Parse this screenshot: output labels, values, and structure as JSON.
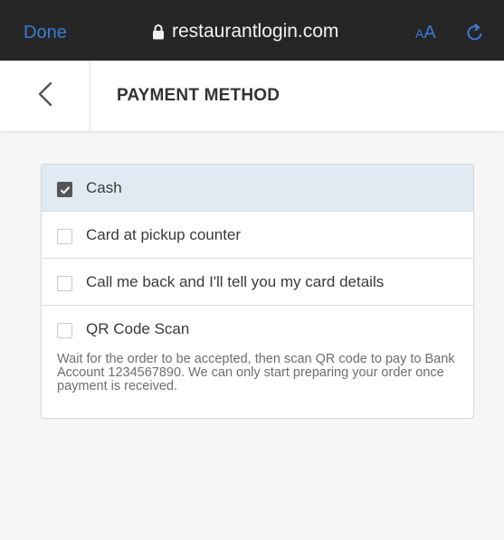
{
  "browser": {
    "done_label": "Done",
    "url": "restaurantlogin.com",
    "text_size_small": "A",
    "text_size_big": "A",
    "accent_color": "#3a7bd5",
    "bar_color": "#262626"
  },
  "header": {
    "back_icon": "chevron-left-icon",
    "title": "PAYMENT METHOD"
  },
  "payment_options": [
    {
      "label": "Cash",
      "checked": true
    },
    {
      "label": "Card at pickup counter",
      "checked": false
    },
    {
      "label": "Call me back and I'll tell you my card details",
      "checked": false
    },
    {
      "label": "QR Code Scan",
      "checked": false,
      "note": "Wait for the order to be accepted, then scan QR code to pay to Bank Account 1234567890. We can only start preparing your order once payment is received."
    }
  ],
  "colors": {
    "selected_row": "#dfeaf3",
    "checkbox_checked": "#555555"
  }
}
